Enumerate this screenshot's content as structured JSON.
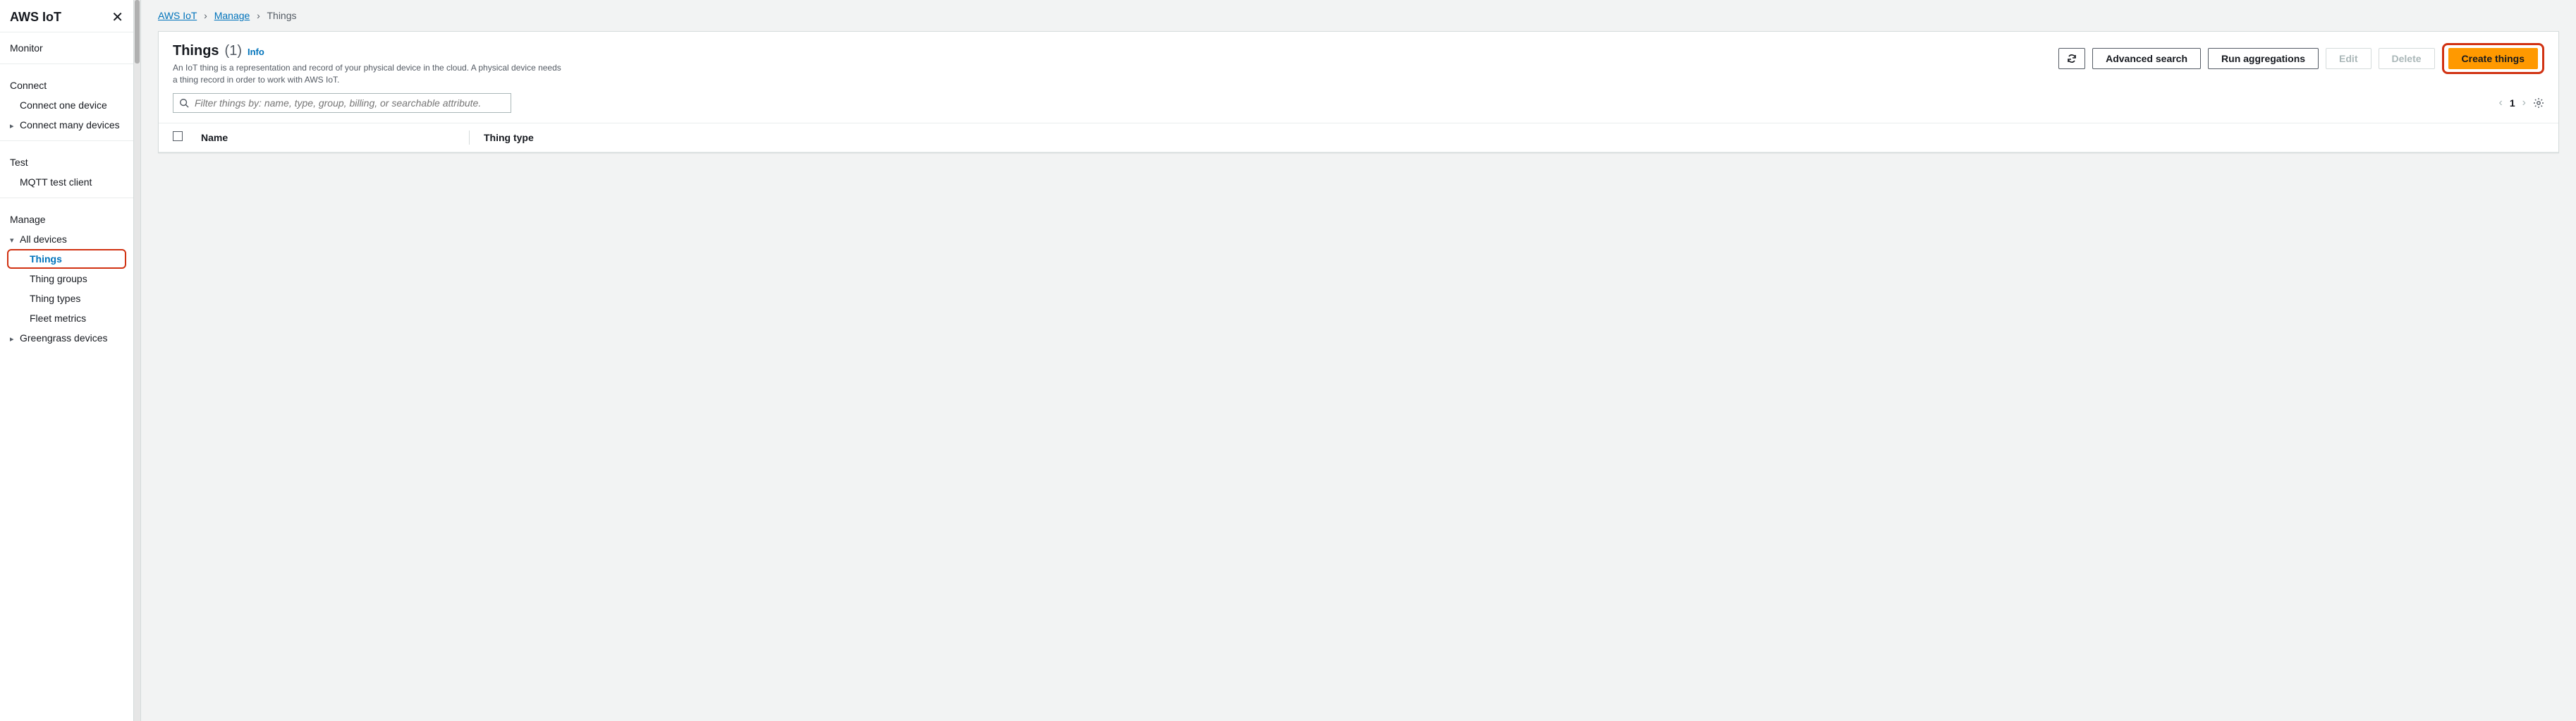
{
  "sidebar": {
    "title": "AWS IoT",
    "sections": {
      "monitor": "Monitor",
      "connect": "Connect",
      "connect_one": "Connect one device",
      "connect_many": "Connect many devices",
      "test": "Test",
      "mqtt": "MQTT test client",
      "manage": "Manage",
      "all_devices": "All devices",
      "things": "Things",
      "thing_groups": "Thing groups",
      "thing_types": "Thing types",
      "fleet_metrics": "Fleet metrics",
      "greengrass": "Greengrass devices"
    }
  },
  "breadcrumbs": {
    "root": "AWS IoT",
    "l1": "Manage",
    "l2": "Things"
  },
  "panel": {
    "title": "Things",
    "count": "(1)",
    "info": "Info",
    "description": "An IoT thing is a representation and record of your physical device in the cloud. A physical device needs a thing record in order to work with AWS IoT."
  },
  "actions": {
    "advanced_search": "Advanced search",
    "run_aggregations": "Run aggregations",
    "edit": "Edit",
    "delete": "Delete",
    "create": "Create things"
  },
  "filter": {
    "placeholder": "Filter things by: name, type, group, billing, or searchable attribute."
  },
  "pager": {
    "page": "1"
  },
  "table": {
    "col_name": "Name",
    "col_type": "Thing type"
  }
}
